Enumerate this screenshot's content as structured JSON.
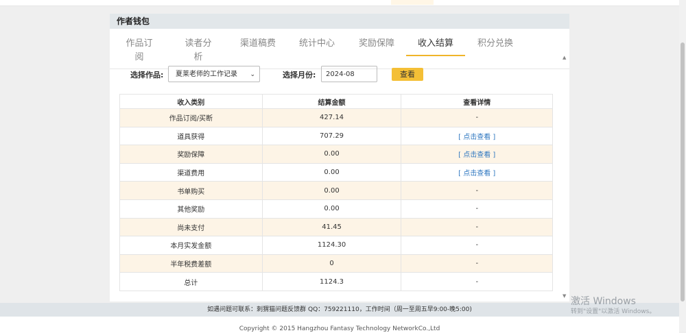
{
  "card": {
    "title": "作者钱包"
  },
  "tabs": [
    "作品订阅",
    "读者分析",
    "渠道稿费",
    "统计中心",
    "奖励保障",
    "收入结算",
    "积分兑换"
  ],
  "active_tab": "收入结算",
  "form": {
    "work_label": "选择作品:",
    "work_value": "夏莱老师的工作记录",
    "month_label": "选择月份:",
    "month_value": "2024-08",
    "query_button": "查看"
  },
  "table": {
    "headers": [
      "收入类别",
      "结算金额",
      "查看详情"
    ],
    "rows": [
      [
        "作品订阅/买断",
        "427.14",
        "-"
      ],
      [
        "道具获得",
        "707.29",
        "[ 点击查看 ]"
      ],
      [
        "奖励保障",
        "0.00",
        "[ 点击查看 ]"
      ],
      [
        "渠道费用",
        "0.00",
        "[ 点击查看 ]"
      ],
      [
        "书单购买",
        "0.00",
        "-"
      ],
      [
        "其他奖励",
        "0.00",
        "-"
      ],
      [
        "尚未支付",
        "41.45",
        "-"
      ],
      [
        "本月实发金额",
        "1124.30",
        "-"
      ],
      [
        "半年税费差额",
        "0",
        "-"
      ],
      [
        "总计",
        "1124.3",
        "-"
      ]
    ]
  },
  "footer": {
    "contact": "如遇问题可联系：刺猬猫问题反馈群 QQ：759221110，工作时间（周一至周五早9:00-晚5:00)",
    "copyright": "Copyright © 2015 Hangzhou Fantasy Technology NetworkCo.,Ltd"
  },
  "watermark": {
    "line1": "激活 Windows",
    "line2": "转到\"设置\"以激活 Windows。"
  },
  "colors": {
    "accent": "#f4bf36",
    "row_highlight": "#fdf4e6",
    "link": "#2f77c0",
    "header_band": "#e2e7ea"
  }
}
